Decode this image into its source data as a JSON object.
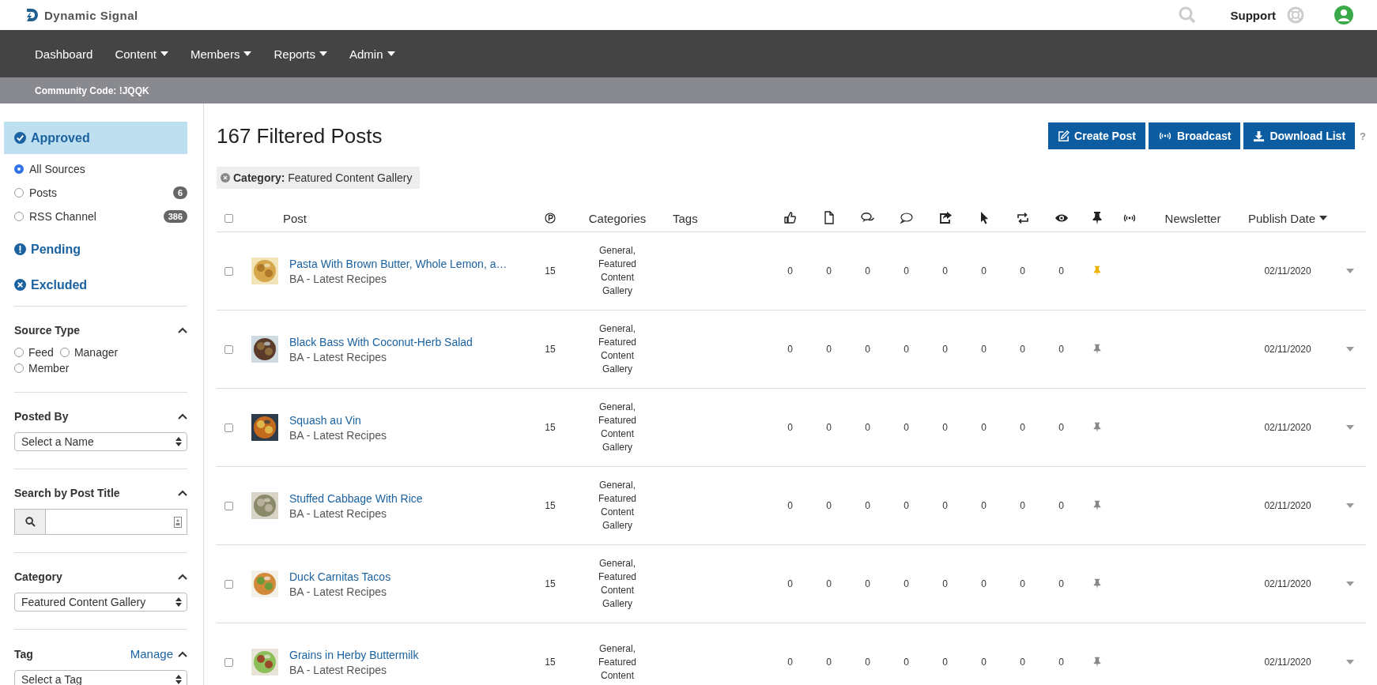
{
  "header": {
    "logo_text": "Dynamic Signal",
    "support_label": "Support"
  },
  "nav": [
    {
      "label": "Dashboard",
      "dropdown": false
    },
    {
      "label": "Content",
      "dropdown": true
    },
    {
      "label": "Members",
      "dropdown": true
    },
    {
      "label": "Reports",
      "dropdown": true
    },
    {
      "label": "Admin",
      "dropdown": true
    }
  ],
  "community_code": "Community Code: !JQQK",
  "sidebar": {
    "statuses": [
      {
        "label": "Approved",
        "kind": "approved",
        "selected": true,
        "sources": [
          {
            "label": "All Sources",
            "selected": true
          },
          {
            "label": "Posts",
            "selected": false,
            "count": "6"
          },
          {
            "label": "RSS Channel",
            "selected": false,
            "count": "386"
          }
        ]
      },
      {
        "label": "Pending",
        "kind": "pending",
        "selected": false
      },
      {
        "label": "Excluded",
        "kind": "excluded",
        "selected": false
      }
    ],
    "sections": [
      {
        "title": "Source Type",
        "kind": "radios",
        "expanded": true,
        "options": [
          {
            "label": "Feed",
            "selected": false
          },
          {
            "label": "Manager",
            "selected": false
          },
          {
            "label": "Member",
            "selected": false
          }
        ]
      },
      {
        "title": "Posted By",
        "kind": "select",
        "expanded": true,
        "value": "Select a Name"
      },
      {
        "title": "Search by Post Title",
        "kind": "search",
        "expanded": true
      },
      {
        "title": "Category",
        "kind": "select",
        "expanded": true,
        "value": "Featured Content Gallery"
      },
      {
        "title": "Tag",
        "kind": "select",
        "expanded": true,
        "link": "Manage",
        "value": "Select a Tag"
      }
    ]
  },
  "main": {
    "title": "167 Filtered Posts",
    "buttons": [
      {
        "label": "Create Post",
        "kind": "create"
      },
      {
        "label": "Broadcast",
        "kind": "broadcast"
      },
      {
        "label": "Download List",
        "kind": "download"
      }
    ],
    "help": "?",
    "filter": {
      "label": "Category:",
      "value": "Featured Content Gallery"
    },
    "columns": {
      "post": "Post",
      "categories": "Categories",
      "tags": "Tags",
      "newsletter": "Newsletter",
      "publish_date": "Publish Date"
    },
    "select_all": {
      "checked": false
    },
    "rows": [
      {
        "checked": false,
        "title": "Pasta With Brown Butter, Whole Lemon, a…",
        "source": "BA - Latest Recipes",
        "points": "15",
        "categories": "General, Featured Content Gallery",
        "metrics": [
          "0",
          "0",
          "0",
          "0",
          "0",
          "0",
          "0",
          "0"
        ],
        "pinned": true,
        "date": "02/11/2020"
      },
      {
        "checked": false,
        "title": "Black Bass With Coconut-Herb Salad",
        "source": "BA - Latest Recipes",
        "points": "15",
        "categories": "General, Featured Content Gallery",
        "metrics": [
          "0",
          "0",
          "0",
          "0",
          "0",
          "0",
          "0",
          "0"
        ],
        "pinned": false,
        "date": "02/11/2020"
      },
      {
        "checked": false,
        "title": "Squash au Vin",
        "source": "BA - Latest Recipes",
        "points": "15",
        "categories": "General, Featured Content Gallery",
        "metrics": [
          "0",
          "0",
          "0",
          "0",
          "0",
          "0",
          "0",
          "0"
        ],
        "pinned": false,
        "date": "02/11/2020"
      },
      {
        "checked": false,
        "title": "Stuffed Cabbage With Rice",
        "source": "BA - Latest Recipes",
        "points": "15",
        "categories": "General, Featured Content Gallery",
        "metrics": [
          "0",
          "0",
          "0",
          "0",
          "0",
          "0",
          "0",
          "0"
        ],
        "pinned": false,
        "date": "02/11/2020"
      },
      {
        "checked": false,
        "title": "Duck Carnitas Tacos",
        "source": "BA - Latest Recipes",
        "points": "15",
        "categories": "General, Featured Content Gallery",
        "metrics": [
          "0",
          "0",
          "0",
          "0",
          "0",
          "0",
          "0",
          "0"
        ],
        "pinned": false,
        "date": "02/11/2020"
      },
      {
        "checked": false,
        "title": "Grains in Herby Buttermilk",
        "source": "BA - Latest Recipes",
        "points": "15",
        "categories": "General, Featured Content",
        "metrics": [
          "0",
          "0",
          "0",
          "0",
          "0",
          "0",
          "0",
          "0"
        ],
        "pinned": false,
        "date": "02/11/2020"
      }
    ]
  }
}
